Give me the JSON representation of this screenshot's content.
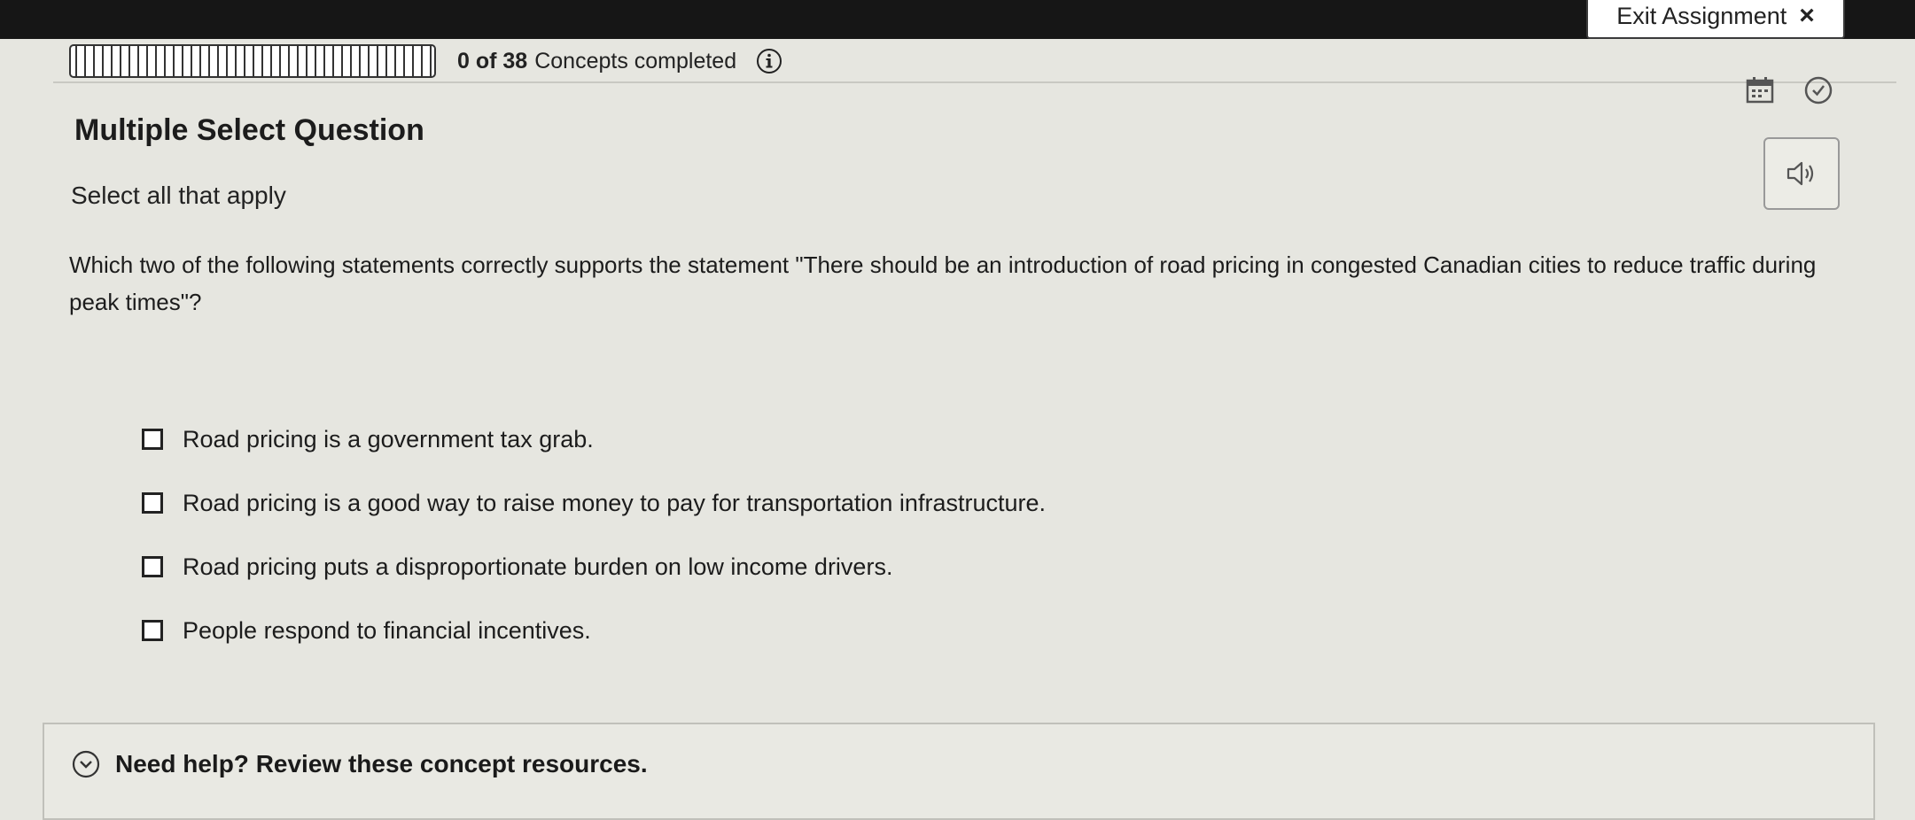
{
  "header": {
    "exit_label": "Exit Assignment",
    "close_glyph": "×"
  },
  "progress": {
    "completed": 0,
    "total": 38,
    "count_label": "0 of 38",
    "text": "Concepts completed",
    "fraction": 0
  },
  "toolbar": {
    "icons": [
      "calendar-icon",
      "check-circle-icon",
      "speaker-icon"
    ]
  },
  "question": {
    "title": "Multiple Select Question",
    "instruction": "Select all that apply",
    "text": "Which two of the following statements correctly supports the statement \"There should be an introduction of road pricing in congested Canadian cities to reduce traffic during peak times\"?",
    "options": [
      {
        "label": "Road pricing is a government tax grab.",
        "checked": false
      },
      {
        "label": "Road pricing is a good way to raise money to pay for transportation infrastructure.",
        "checked": false
      },
      {
        "label": "Road pricing puts a disproportionate burden on low income drivers.",
        "checked": false
      },
      {
        "label": "People respond to financial incentives.",
        "checked": false
      }
    ]
  },
  "help": {
    "label": "Need help? Review these concept resources."
  },
  "colors": {
    "topbar": "#161616",
    "page_background": "#e6e6e0",
    "progress_fill": "#2f6fd6"
  }
}
